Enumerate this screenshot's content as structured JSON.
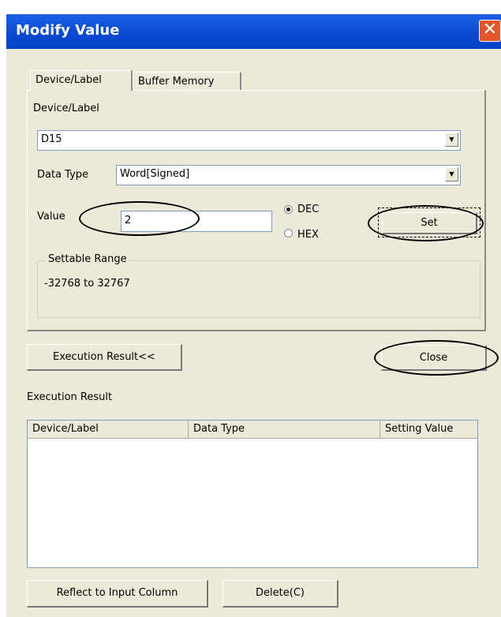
{
  "window": {
    "title": "Modify Value",
    "close_symbol": "✕"
  },
  "tabs": [
    {
      "label": "Device/Label"
    },
    {
      "label": "Buffer Memory"
    }
  ],
  "device": {
    "label": "Device/Label",
    "value": "D15"
  },
  "data_type": {
    "label": "Data Type",
    "value": "Word[Signed]"
  },
  "value_field": {
    "label": "Value",
    "value": "2"
  },
  "radix": {
    "dec": "DEC",
    "hex": "HEX",
    "selected": "DEC"
  },
  "set_button": "Set",
  "range": {
    "legend": "Settable Range",
    "text": "-32768 to 32767"
  },
  "execution_toggle": "Execution Result<<",
  "close_button": "Close",
  "result": {
    "heading": "Execution Result",
    "columns": [
      "Device/Label",
      "Data Type",
      "Setting Value"
    ],
    "rows": []
  },
  "reflect_button": "Reflect to Input Column",
  "delete_button": "Delete(C)",
  "colors": {
    "title_bar": "#0a49d3",
    "face": "#ece9d8",
    "close_red": "#e1572c"
  }
}
